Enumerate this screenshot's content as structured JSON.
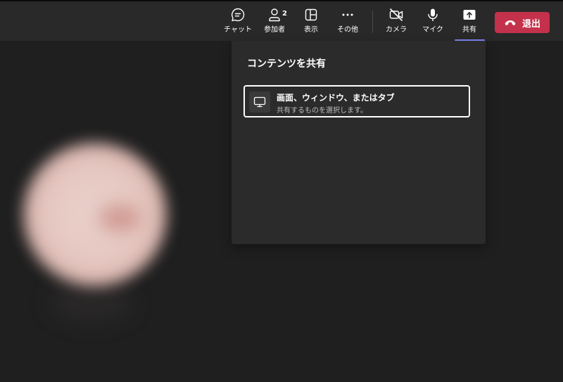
{
  "toolbar": {
    "chat": {
      "label": "チャット",
      "icon": "chat-icon"
    },
    "participants": {
      "label": "参加者",
      "count": "2",
      "icon": "people-icon"
    },
    "view": {
      "label": "表示",
      "icon": "layout-grid-icon"
    },
    "more": {
      "label": "その他",
      "icon": "more-dots-icon"
    },
    "camera": {
      "label": "カメラ",
      "icon": "camera-off-icon",
      "state": "off"
    },
    "mic": {
      "label": "マイク",
      "icon": "mic-icon",
      "state": "on"
    },
    "share": {
      "label": "共有",
      "icon": "share-upload-icon",
      "active": true
    },
    "leave": {
      "label": "退出",
      "icon": "hang-up-icon",
      "color": "#c4314b"
    }
  },
  "share_panel": {
    "title": "コンテンツを共有",
    "options": [
      {
        "title": "画面、ウィンドウ、またはタブ",
        "subtitle": "共有するものを選択します。",
        "icon": "monitor-icon"
      }
    ]
  },
  "colors": {
    "background": "#1f1f1f",
    "toolbar": "#292929",
    "panel": "#2b2b2b",
    "accent_underline": "#7f85f5",
    "leave_button": "#c4314b"
  }
}
